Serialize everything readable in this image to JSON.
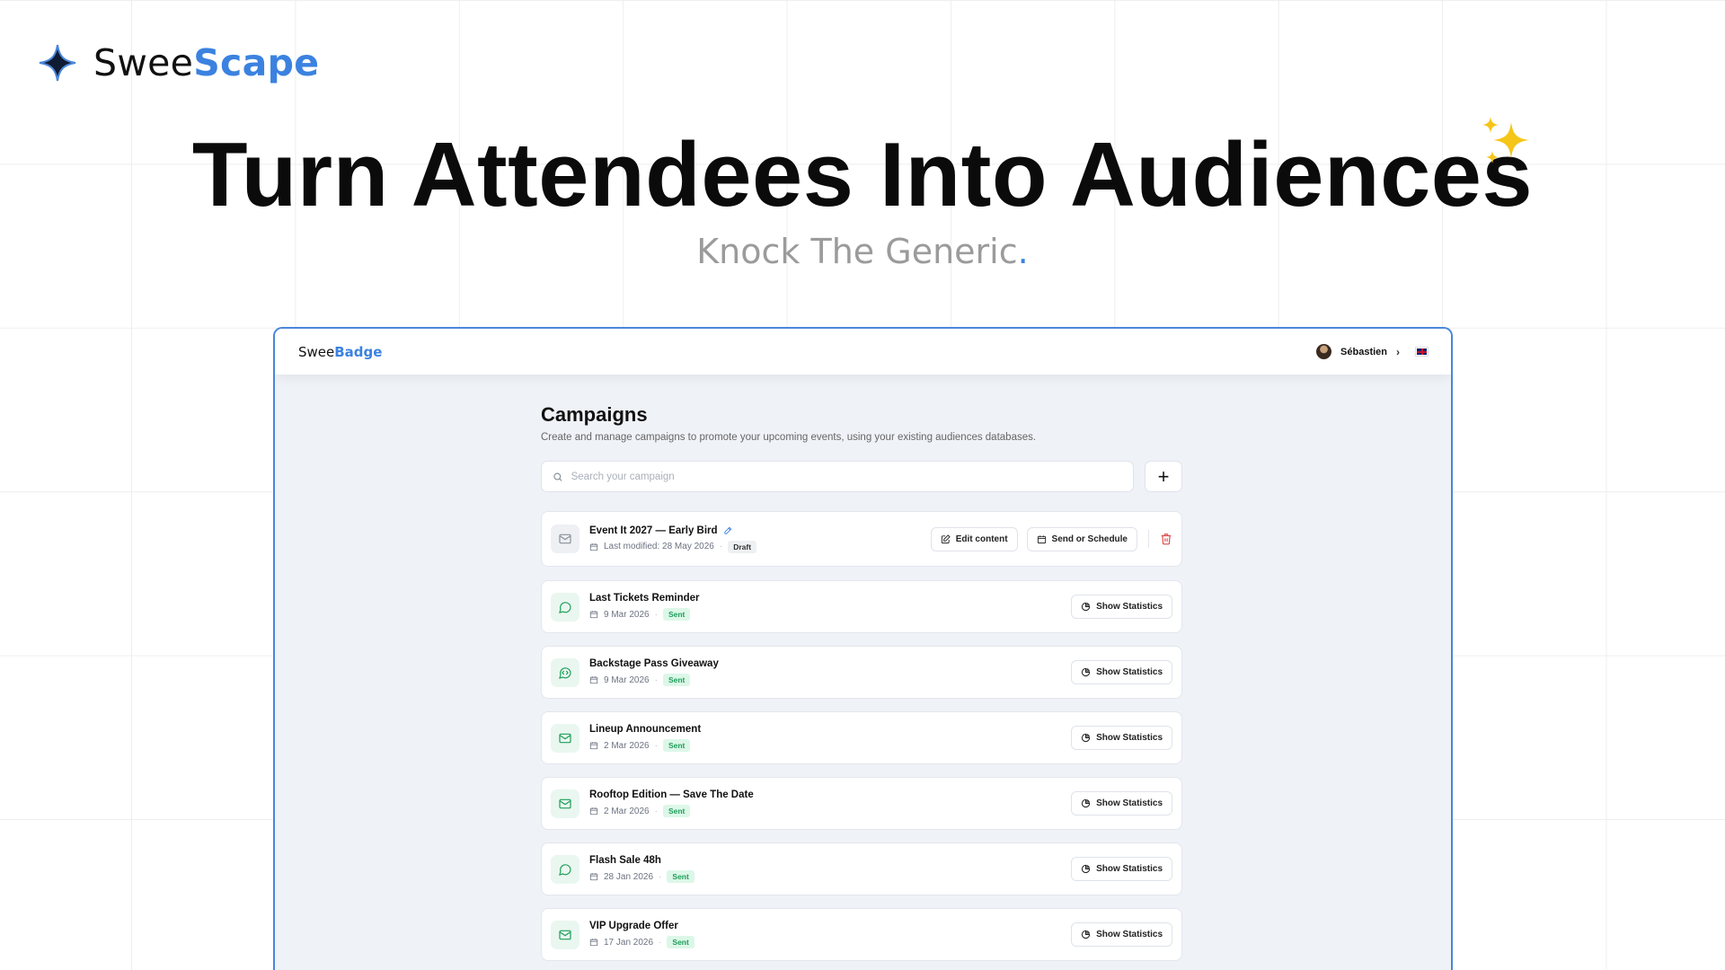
{
  "brand": {
    "part1": "Swee",
    "part2": "Scape"
  },
  "hero": {
    "title": "Turn Attendees Into Audiences",
    "subtitle": "Knock The Generic",
    "subtitle_dot": "."
  },
  "app": {
    "logo_part1": "Swee",
    "logo_part2": "Badge",
    "user_name": "Sébastien",
    "chevron": "›",
    "page_title": "Campaigns",
    "page_description": "Create and manage campaigns to promote your upcoming events, using your existing audiences databases.",
    "search_placeholder": "Search your campaign",
    "add_label": "+",
    "draft": {
      "name": "Event It 2027 — Early Bird",
      "modified": "Last modified: 28 May 2026",
      "status": "Draft",
      "edit_label": "Edit content",
      "send_label": "Send or Schedule"
    },
    "separator": "·",
    "stats_label": "Show Statistics",
    "campaigns": [
      {
        "name": "Last Tickets Reminder",
        "date": "9 Mar 2026",
        "status": "Sent",
        "icon": "chat-icon"
      },
      {
        "name": "Backstage Pass Giveaway",
        "date": "9 Mar 2026",
        "status": "Sent",
        "icon": "chat-code-icon"
      },
      {
        "name": "Lineup Announcement",
        "date": "2 Mar 2026",
        "status": "Sent",
        "icon": "mail-icon"
      },
      {
        "name": "Rooftop Edition — Save The Date",
        "date": "2 Mar 2026",
        "status": "Sent",
        "icon": "mail-icon"
      },
      {
        "name": "Flash Sale 48h",
        "date": "28 Jan 2026",
        "status": "Sent",
        "icon": "chat-icon"
      },
      {
        "name": "VIP Upgrade Offer",
        "date": "17 Jan 2026",
        "status": "Sent",
        "icon": "mail-icon"
      }
    ]
  },
  "colors": {
    "accent": "#3b82e0",
    "sent_green": "#1f9d5a",
    "delete_red": "#e04848"
  }
}
